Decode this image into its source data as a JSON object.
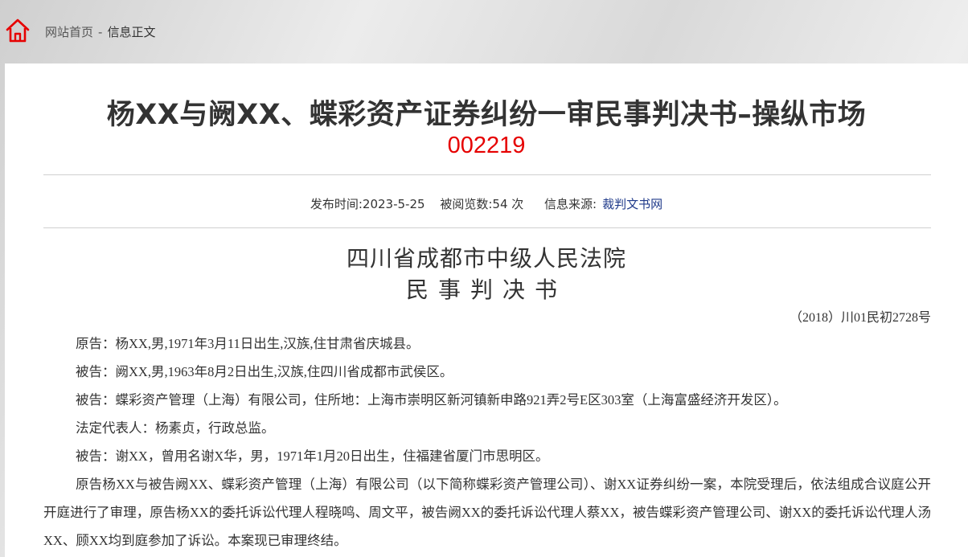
{
  "breadcrumb": {
    "home": "网站首页",
    "separator": "-",
    "current": "信息正文"
  },
  "article": {
    "title": "杨XX与阙XX、蝶彩资产证券纠纷一审民事判决书–操纵市场",
    "code": "002219",
    "meta": {
      "publish_time": "发布时间:2023-5-25",
      "views": "被阅览数:54 次",
      "source_label": "信息来源:",
      "source_link": "裁判文书网"
    }
  },
  "document": {
    "court": "四川省成都市中级人民法院",
    "doc_type": "民事判决书",
    "case_no": "（2018）川01民初2728号",
    "paragraphs": [
      "原告：杨XX,男,1971年3月11日出生,汉族,住甘肃省庆城县。",
      "被告：阙XX,男,1963年8月2日出生,汉族,住四川省成都市武侯区。",
      "被告：蝶彩资产管理（上海）有限公司，住所地：上海市崇明区新河镇新申路921弄2号E区303室（上海富盛经济开发区）。",
      "法定代表人：杨素贞，行政总监。",
      "被告：谢XX，曾用名谢X华，男，1971年1月20日出生，住福建省厦门市思明区。",
      "原告杨XX与被告阙XX、蝶彩资产管理（上海）有限公司（以下简称蝶彩资产管理公司）、谢XX证券纠纷一案，本院受理后，依法组成合议庭公开开庭进行了审理，原告杨XX的委托诉讼代理人程晓鸣、周文平，被告阙XX的委托诉讼代理人蔡XX，被告蝶彩资产管理公司、谢XX的委托诉讼代理人汤XX、顾XX均到庭参加了诉讼。本案现已审理终结。"
    ]
  },
  "colors": {
    "accent": "#e60000",
    "link": "#1f3a8a",
    "text": "#333333"
  },
  "icons": {
    "home": "home-icon"
  }
}
